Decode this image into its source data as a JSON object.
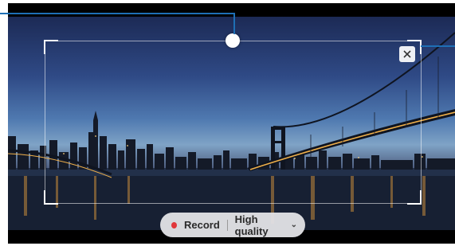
{
  "recorder": {
    "record_label": "Record",
    "quality_label": "High quality",
    "dropdown_icon": "chevron-down-icon",
    "close_icon": "close-icon",
    "record_color": "#e1373b"
  },
  "callout_color": "#1e6fb5"
}
